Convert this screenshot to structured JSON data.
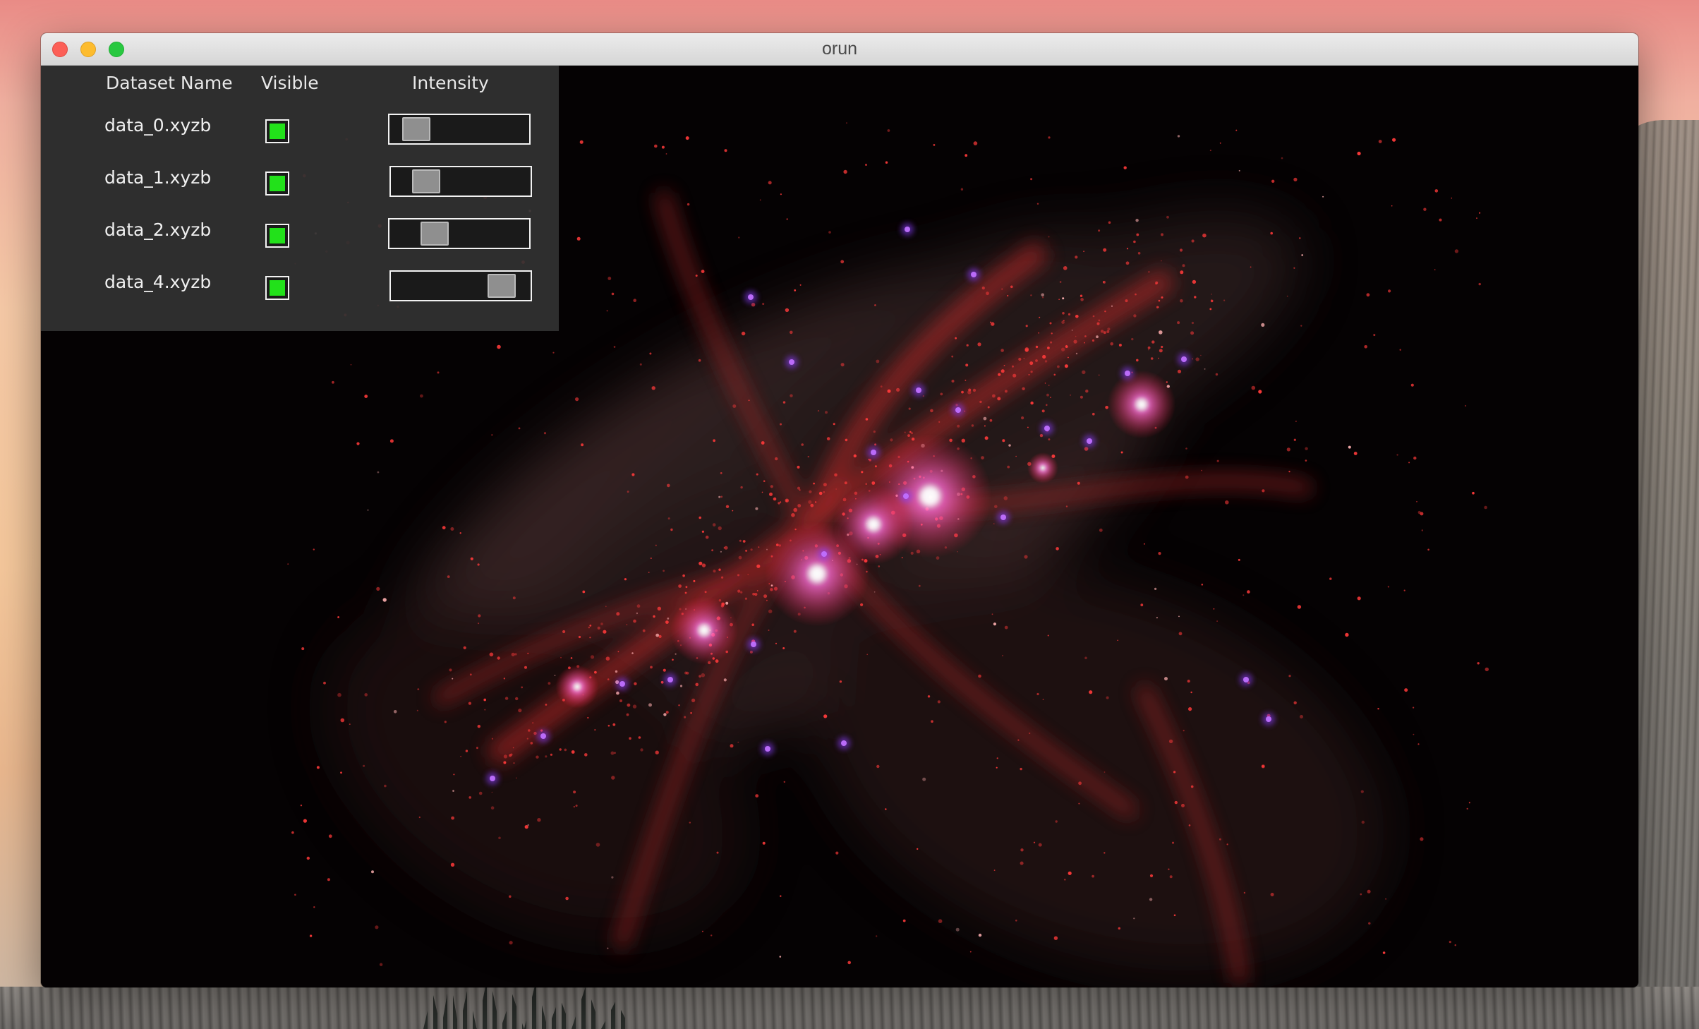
{
  "window": {
    "title": "orun"
  },
  "panel": {
    "headers": {
      "name": "Dataset Name",
      "visible": "Visible",
      "intensity": "Intensity"
    },
    "datasets": [
      {
        "name": "data_0.xyzb",
        "visible": true,
        "intensity": 0.1
      },
      {
        "name": "data_1.xyzb",
        "visible": true,
        "intensity": 0.18
      },
      {
        "name": "data_2.xyzb",
        "visible": true,
        "intensity": 0.27
      },
      {
        "name": "data_4.xyzb",
        "visible": true,
        "intensity": 0.88
      }
    ]
  },
  "colors": {
    "checkbox_on": "#22e11a",
    "panel_bg": "#323232",
    "viewport_bg": "#050203",
    "filament_red": "#ff3a3a",
    "halo_magenta": "#ff40ff",
    "halo_violet": "#7a3bff"
  }
}
